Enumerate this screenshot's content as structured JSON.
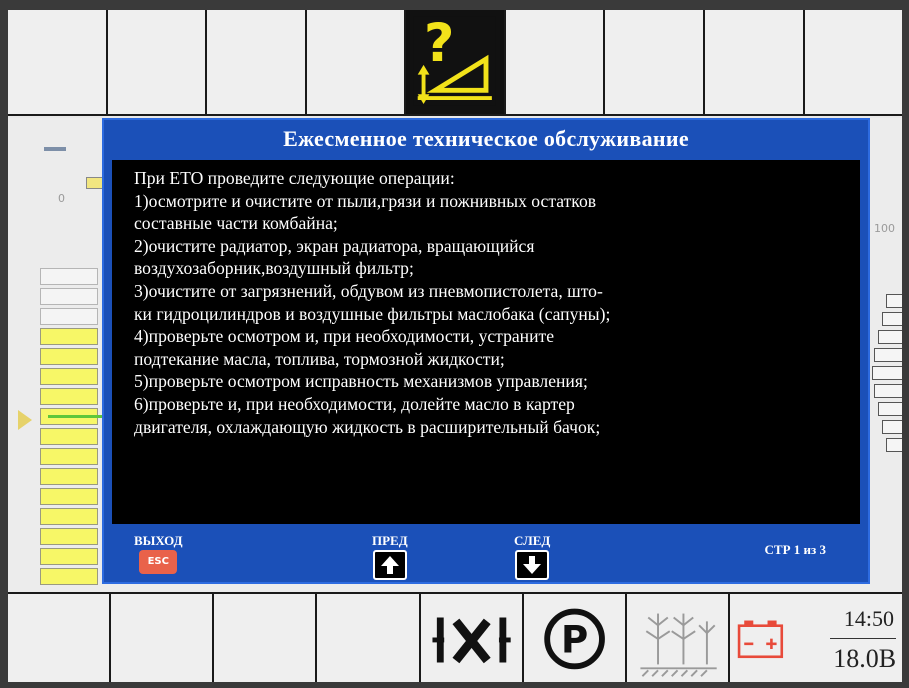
{
  "top_bar": {
    "cells": [
      "",
      "",
      "",
      "",
      "",
      "",
      "",
      "",
      ""
    ],
    "active_icon": "help-machine-icon"
  },
  "gauges": {
    "left_zero_label": "0",
    "right_hundred_label": "100",
    "left_scale_filled_segments": 13,
    "left_scale_total_segments": 16
  },
  "dialog": {
    "title": "Ежесменное техническое обслуживание",
    "lines": [
      "При ЕТО проведите следующие операции:",
      "1)осмотрите и очистите от пыли,грязи и пожнивных остатков",
      "составные части комбайна;",
      "2)очистите радиатор, экран радиатора, вращающийся",
      "воздухозаборник,воздушный фильтр;",
      "3)очистите от загрязнений, обдувом из пневмопистолета, што-",
      "ки гидроцилиндров и воздушные фильтры маслобака (сапуны);",
      "4)проверьте осмотром и, при необходимости, устраните",
      "подтекание масла, топлива, тормозной жидкости;",
      "5)проверьте осмотром исправность механизмов управления;",
      "6)проверьте и, при необходимости, долейте масло в картер",
      "двигателя, охлаждающую жидкость в расширительный бачок;"
    ],
    "footer": {
      "exit_label": "ВЫХОД",
      "esc_key": "ESC",
      "prev_label": "ПРЕД",
      "next_label": "СЛЕД",
      "page_indicator": "СТР 1 из 3"
    }
  },
  "bottom_bar": {
    "icons": [
      "",
      "",
      "",
      "",
      "neutral-gear-icon",
      "parking-brake-icon",
      "crop-field-icon",
      "battery-icon"
    ],
    "time": "14:50",
    "voltage": "18.0В"
  },
  "colors": {
    "dialog_blue": "#1b50b8",
    "icon_yellow": "#f2e21a",
    "battery_red": "#e84a3a"
  }
}
